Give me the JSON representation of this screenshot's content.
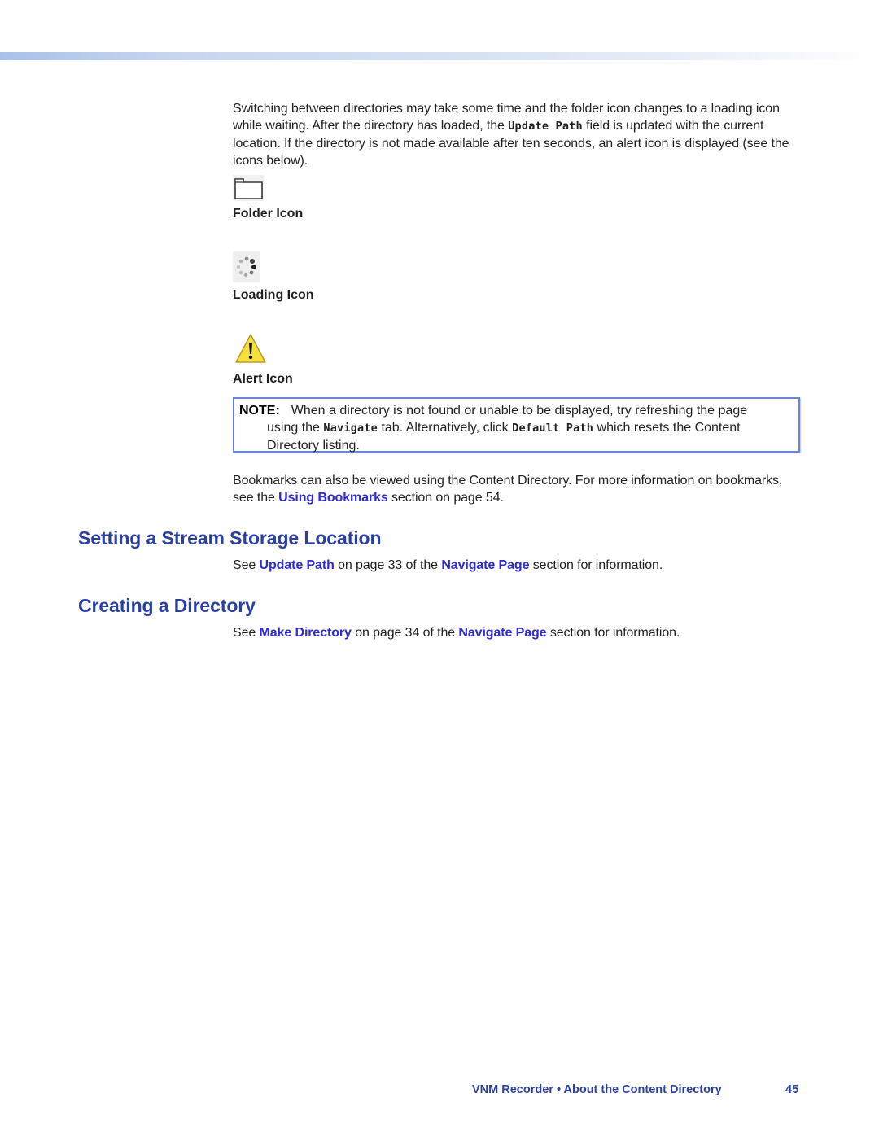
{
  "header": {
    "band_colors": [
      "#a9c1e8",
      "#d6e0f2",
      "#ffffff"
    ]
  },
  "intro": {
    "part1": "Switching between directories may take some time and the folder icon changes to a loading icon while waiting. After the directory has loaded, the ",
    "update_path": "Update Path",
    "part2": " field is updated with the current location. If the directory is not made available after ten seconds, an alert icon is displayed (see the icons below)."
  },
  "icons": [
    {
      "label": "Folder Icon",
      "icon": "folder-icon"
    },
    {
      "label": "Loading Icon",
      "icon": "loading-spinner-icon"
    },
    {
      "label": "Alert Icon",
      "icon": "warning-triangle-icon"
    }
  ],
  "note": {
    "label": "NOTE:",
    "part1": "When a directory is not found or unable to be displayed, try refreshing the page",
    "part2": "using the ",
    "navigate": "Navigate",
    "part3": " tab. Alternatively, click ",
    "default_path": "Default Path",
    "part4": " which resets the Content Directory listing."
  },
  "bookmarks": {
    "part1": "Bookmarks can also be viewed using the Content Directory. For more information on bookmarks, see the ",
    "link": "Using Bookmarks",
    "part2": " section on page 54."
  },
  "sections": [
    {
      "heading": "Setting a Stream Storage Location",
      "pre": "See ",
      "link1": "Update Path",
      "mid": " on page 33 of the ",
      "link2": "Navigate Page",
      "post": " section for information."
    },
    {
      "heading": "Creating a Directory",
      "pre": "See ",
      "link1": "Make Directory",
      "mid": " on page 34 of the ",
      "link2": "Navigate Page",
      "post": " section for information."
    }
  ],
  "footer": {
    "title": "VNM Recorder • About the Content Directory",
    "page_number": "45"
  },
  "colors": {
    "heading": "#2b3f9e",
    "link": "#2d2ad6",
    "note_border": "#6b86d6",
    "alert_yellow": "#f5e13a"
  }
}
